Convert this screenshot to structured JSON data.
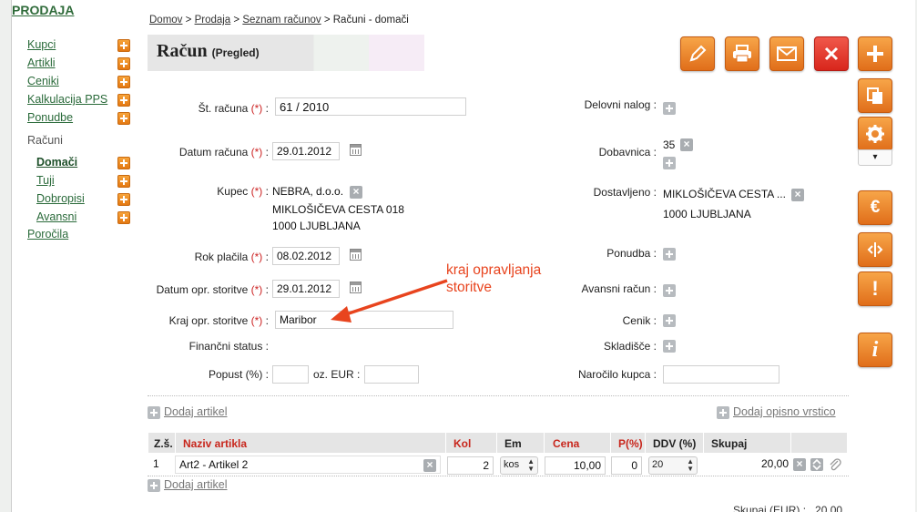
{
  "sidebar": {
    "title": "PRODAJA",
    "items": [
      {
        "label": "Kupci"
      },
      {
        "label": "Artikli"
      },
      {
        "label": "Ceniki"
      },
      {
        "label": "Kalkulacija PPS"
      },
      {
        "label": "Ponudbe"
      }
    ],
    "section": "Računi",
    "sub_items": [
      {
        "label": "Domači"
      },
      {
        "label": "Tuji"
      },
      {
        "label": "Dobropisi"
      },
      {
        "label": "Avansni"
      }
    ],
    "reports": "Poročila"
  },
  "breadcrumb": {
    "items": [
      "Domov",
      "Prodaja",
      "Seznam računov"
    ],
    "separator": ">",
    "current": "Računi - domači"
  },
  "page": {
    "title": "Račun",
    "subtitle": "(Pregled)"
  },
  "toolbar": {
    "icons": [
      "pencil-icon",
      "print-icon",
      "mail-icon",
      "close-icon",
      "plus-icon",
      "copy-icon",
      "gear-icon",
      "euro-icon",
      "split-icon",
      "warning-icon",
      "info-icon"
    ],
    "euro": "€",
    "warning": "!",
    "info": "i",
    "dropdown": "▾"
  },
  "form": {
    "required_mark": "(*)",
    "colon": ":",
    "invoice_no": {
      "label": "Št. računa",
      "value": "61 / 2010"
    },
    "invoice_date": {
      "label": "Datum računa",
      "value": "29.01.2012"
    },
    "customer": {
      "label": "Kupec",
      "name": "NEBRA, d.o.o.",
      "street": "MIKLOŠIČEVA CESTA 018",
      "city": "1000 LJUBLJANA"
    },
    "due_date": {
      "label": "Rok plačila",
      "value": "08.02.2012"
    },
    "service_date": {
      "label": "Datum opr. storitve",
      "value": "29.01.2012"
    },
    "service_place": {
      "label": "Kraj opr. storitve",
      "value": "Maribor"
    },
    "financial_status": {
      "label": "Finančni status :"
    },
    "discount": {
      "label": "Popust (%) :",
      "eur_label": "oz. EUR :",
      "percent": "",
      "eur": ""
    },
    "work_order": {
      "label": "Delovni nalog :"
    },
    "delivery_note": {
      "label": "Dobavnica :",
      "value": "35"
    },
    "delivered_to": {
      "label": "Dostavljeno :",
      "line1": "MIKLOŠIČEVA CESTA ...",
      "line2": "1000 LJUBLJANA"
    },
    "offer": {
      "label": "Ponudba :"
    },
    "advance_invoice": {
      "label": "Avansni račun :"
    },
    "price_list": {
      "label": "Cenik :"
    },
    "warehouse": {
      "label": "Skladišče :"
    },
    "customer_order": {
      "label": "Naročilo kupca :",
      "value": ""
    }
  },
  "annotation": {
    "line1": "kraj opravljanja",
    "line2": "storitve"
  },
  "items": {
    "add_item": "Dodaj artikel",
    "add_desc_row": "Dodaj opisno vrstico",
    "columns": [
      "Z.š.",
      "Naziv artikla",
      "Kol",
      "Em",
      "Cena",
      "P(%)",
      "DDV (%)",
      "Skupaj"
    ],
    "rows": [
      {
        "no": "1",
        "name": "Art2 - Artikel 2",
        "qty": "2",
        "unit": "kos",
        "price": "10,00",
        "discount": "0",
        "vat": "20",
        "total": "20,00"
      }
    ],
    "total_label": "Skupaj (EUR) :",
    "total_value": "20,00"
  },
  "colors": {
    "accent_orange": "#e8801e",
    "danger_red": "#d8261c",
    "link_green": "#2a6a3a",
    "annotation": "#e8441e"
  }
}
